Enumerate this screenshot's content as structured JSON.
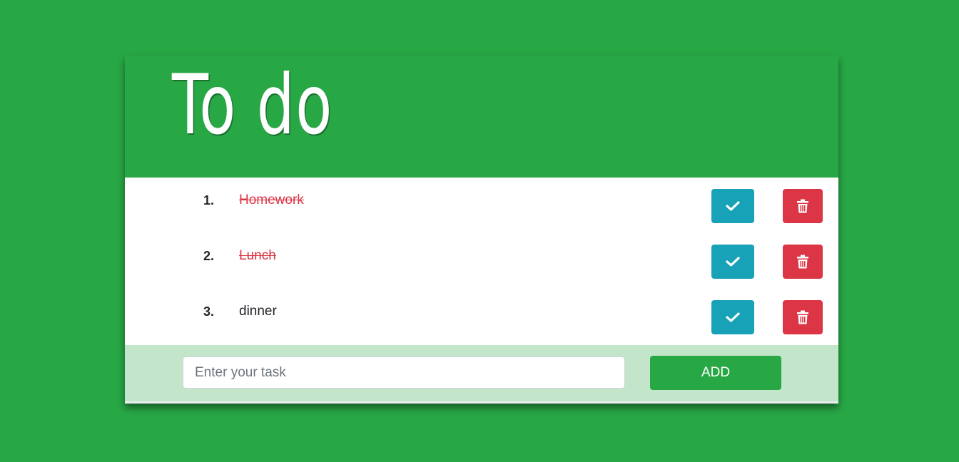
{
  "header": {
    "title": "To do"
  },
  "tasks": [
    {
      "number": "1.",
      "text": "Homework",
      "done": true
    },
    {
      "number": "2.",
      "text": "Lunch",
      "done": true
    },
    {
      "number": "3.",
      "text": "dinner",
      "done": false
    }
  ],
  "icons": {
    "complete": "check-icon",
    "delete": "trash-icon"
  },
  "form": {
    "placeholder": "Enter your task",
    "value": "",
    "add_label": "ADD"
  },
  "colors": {
    "background": "#28a745",
    "complete_button": "#17a2b8",
    "delete_button": "#dc3545",
    "done_text": "#dc3545",
    "footer": "#c3e6cb"
  }
}
